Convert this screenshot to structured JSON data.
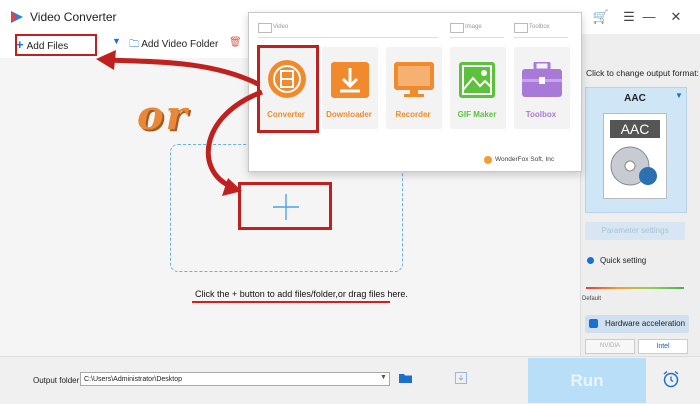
{
  "window": {
    "title": "Video Converter"
  },
  "toolbar": {
    "add_files_label": "Add Files",
    "add_folder_label": "Add Video Folder"
  },
  "main": {
    "hint": "Click the + button to add files/folder,or drag files here."
  },
  "popup": {
    "sections": {
      "video": "Video",
      "image": "Image",
      "toolbox": "Toolbox"
    },
    "tiles": [
      {
        "label": "Converter",
        "icon": "film-convert-icon",
        "color": "#f08a2c",
        "text_color": "#f08a2c"
      },
      {
        "label": "Downloader",
        "icon": "download-icon",
        "color": "#f08a2c",
        "text_color": "#f08a2c"
      },
      {
        "label": "Recorder",
        "icon": "monitor-record-icon",
        "color": "#f08a2c",
        "text_color": "#f08a2c"
      },
      {
        "label": "GIF Maker",
        "icon": "image-gif-icon",
        "color": "#5cc13c",
        "text_color": "#5cc13c"
      },
      {
        "label": "Toolbox",
        "icon": "toolbox-icon",
        "color": "#a87ad8",
        "text_color": "#a87ad8"
      }
    ],
    "footer": "WonderFox Soft, Inc"
  },
  "right_panel": {
    "change_label": "Click to change output format:",
    "format": "AAC",
    "parameter_settings": "Parameter settings",
    "quick_setting": "Quick setting",
    "default_label": "Default",
    "hardware_acceleration": "Hardware acceleration",
    "nvidia": "NVIDIA",
    "intel": "Intel"
  },
  "bottom": {
    "output_label": "Output folder:",
    "output_path": "C:\\Users\\Administrator\\Desktop",
    "run_label": "Run"
  },
  "annotations": {
    "or": "or"
  },
  "colors": {
    "accent": "#1b6fd1",
    "annotation_red": "#c0201e",
    "orange": "#f08a2c",
    "run_bg": "#b8dff7"
  }
}
